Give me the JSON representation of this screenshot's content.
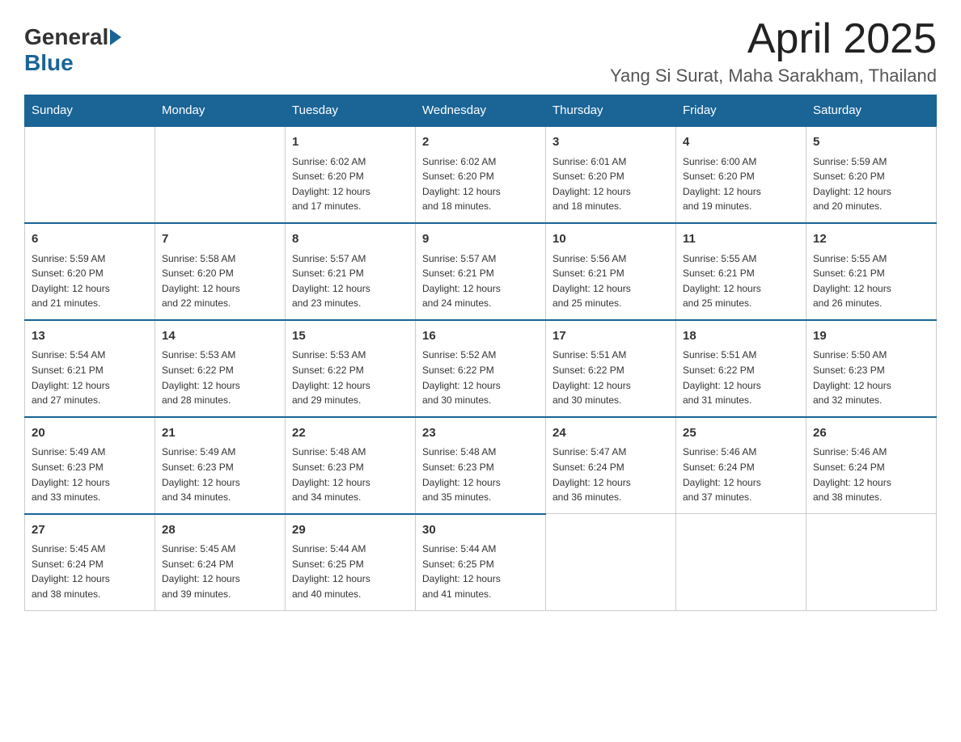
{
  "header": {
    "logo_general": "General",
    "logo_blue": "Blue",
    "month_title": "April 2025",
    "location": "Yang Si Surat, Maha Sarakham, Thailand"
  },
  "weekdays": [
    "Sunday",
    "Monday",
    "Tuesday",
    "Wednesday",
    "Thursday",
    "Friday",
    "Saturday"
  ],
  "weeks": [
    [
      {
        "day": "",
        "info": ""
      },
      {
        "day": "",
        "info": ""
      },
      {
        "day": "1",
        "info": "Sunrise: 6:02 AM\nSunset: 6:20 PM\nDaylight: 12 hours\nand 17 minutes."
      },
      {
        "day": "2",
        "info": "Sunrise: 6:02 AM\nSunset: 6:20 PM\nDaylight: 12 hours\nand 18 minutes."
      },
      {
        "day": "3",
        "info": "Sunrise: 6:01 AM\nSunset: 6:20 PM\nDaylight: 12 hours\nand 18 minutes."
      },
      {
        "day": "4",
        "info": "Sunrise: 6:00 AM\nSunset: 6:20 PM\nDaylight: 12 hours\nand 19 minutes."
      },
      {
        "day": "5",
        "info": "Sunrise: 5:59 AM\nSunset: 6:20 PM\nDaylight: 12 hours\nand 20 minutes."
      }
    ],
    [
      {
        "day": "6",
        "info": "Sunrise: 5:59 AM\nSunset: 6:20 PM\nDaylight: 12 hours\nand 21 minutes."
      },
      {
        "day": "7",
        "info": "Sunrise: 5:58 AM\nSunset: 6:20 PM\nDaylight: 12 hours\nand 22 minutes."
      },
      {
        "day": "8",
        "info": "Sunrise: 5:57 AM\nSunset: 6:21 PM\nDaylight: 12 hours\nand 23 minutes."
      },
      {
        "day": "9",
        "info": "Sunrise: 5:57 AM\nSunset: 6:21 PM\nDaylight: 12 hours\nand 24 minutes."
      },
      {
        "day": "10",
        "info": "Sunrise: 5:56 AM\nSunset: 6:21 PM\nDaylight: 12 hours\nand 25 minutes."
      },
      {
        "day": "11",
        "info": "Sunrise: 5:55 AM\nSunset: 6:21 PM\nDaylight: 12 hours\nand 25 minutes."
      },
      {
        "day": "12",
        "info": "Sunrise: 5:55 AM\nSunset: 6:21 PM\nDaylight: 12 hours\nand 26 minutes."
      }
    ],
    [
      {
        "day": "13",
        "info": "Sunrise: 5:54 AM\nSunset: 6:21 PM\nDaylight: 12 hours\nand 27 minutes."
      },
      {
        "day": "14",
        "info": "Sunrise: 5:53 AM\nSunset: 6:22 PM\nDaylight: 12 hours\nand 28 minutes."
      },
      {
        "day": "15",
        "info": "Sunrise: 5:53 AM\nSunset: 6:22 PM\nDaylight: 12 hours\nand 29 minutes."
      },
      {
        "day": "16",
        "info": "Sunrise: 5:52 AM\nSunset: 6:22 PM\nDaylight: 12 hours\nand 30 minutes."
      },
      {
        "day": "17",
        "info": "Sunrise: 5:51 AM\nSunset: 6:22 PM\nDaylight: 12 hours\nand 30 minutes."
      },
      {
        "day": "18",
        "info": "Sunrise: 5:51 AM\nSunset: 6:22 PM\nDaylight: 12 hours\nand 31 minutes."
      },
      {
        "day": "19",
        "info": "Sunrise: 5:50 AM\nSunset: 6:23 PM\nDaylight: 12 hours\nand 32 minutes."
      }
    ],
    [
      {
        "day": "20",
        "info": "Sunrise: 5:49 AM\nSunset: 6:23 PM\nDaylight: 12 hours\nand 33 minutes."
      },
      {
        "day": "21",
        "info": "Sunrise: 5:49 AM\nSunset: 6:23 PM\nDaylight: 12 hours\nand 34 minutes."
      },
      {
        "day": "22",
        "info": "Sunrise: 5:48 AM\nSunset: 6:23 PM\nDaylight: 12 hours\nand 34 minutes."
      },
      {
        "day": "23",
        "info": "Sunrise: 5:48 AM\nSunset: 6:23 PM\nDaylight: 12 hours\nand 35 minutes."
      },
      {
        "day": "24",
        "info": "Sunrise: 5:47 AM\nSunset: 6:24 PM\nDaylight: 12 hours\nand 36 minutes."
      },
      {
        "day": "25",
        "info": "Sunrise: 5:46 AM\nSunset: 6:24 PM\nDaylight: 12 hours\nand 37 minutes."
      },
      {
        "day": "26",
        "info": "Sunrise: 5:46 AM\nSunset: 6:24 PM\nDaylight: 12 hours\nand 38 minutes."
      }
    ],
    [
      {
        "day": "27",
        "info": "Sunrise: 5:45 AM\nSunset: 6:24 PM\nDaylight: 12 hours\nand 38 minutes."
      },
      {
        "day": "28",
        "info": "Sunrise: 5:45 AM\nSunset: 6:24 PM\nDaylight: 12 hours\nand 39 minutes."
      },
      {
        "day": "29",
        "info": "Sunrise: 5:44 AM\nSunset: 6:25 PM\nDaylight: 12 hours\nand 40 minutes."
      },
      {
        "day": "30",
        "info": "Sunrise: 5:44 AM\nSunset: 6:25 PM\nDaylight: 12 hours\nand 41 minutes."
      },
      {
        "day": "",
        "info": ""
      },
      {
        "day": "",
        "info": ""
      },
      {
        "day": "",
        "info": ""
      }
    ]
  ]
}
